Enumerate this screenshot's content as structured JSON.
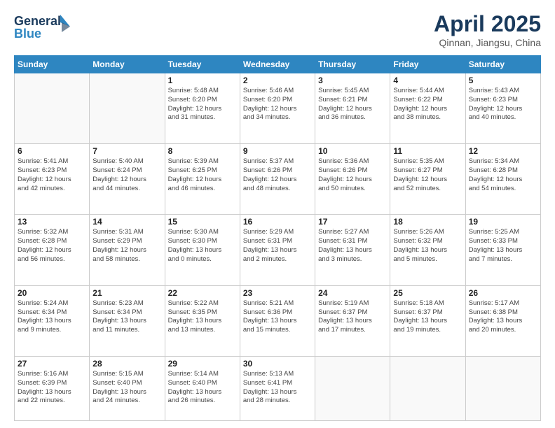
{
  "header": {
    "logo_line1": "General",
    "logo_line2": "Blue",
    "month_title": "April 2025",
    "subtitle": "Qinnan, Jiangsu, China"
  },
  "days_of_week": [
    "Sunday",
    "Monday",
    "Tuesday",
    "Wednesday",
    "Thursday",
    "Friday",
    "Saturday"
  ],
  "weeks": [
    [
      {
        "day": "",
        "info": ""
      },
      {
        "day": "",
        "info": ""
      },
      {
        "day": "1",
        "info": "Sunrise: 5:48 AM\nSunset: 6:20 PM\nDaylight: 12 hours\nand 31 minutes."
      },
      {
        "day": "2",
        "info": "Sunrise: 5:46 AM\nSunset: 6:20 PM\nDaylight: 12 hours\nand 34 minutes."
      },
      {
        "day": "3",
        "info": "Sunrise: 5:45 AM\nSunset: 6:21 PM\nDaylight: 12 hours\nand 36 minutes."
      },
      {
        "day": "4",
        "info": "Sunrise: 5:44 AM\nSunset: 6:22 PM\nDaylight: 12 hours\nand 38 minutes."
      },
      {
        "day": "5",
        "info": "Sunrise: 5:43 AM\nSunset: 6:23 PM\nDaylight: 12 hours\nand 40 minutes."
      }
    ],
    [
      {
        "day": "6",
        "info": "Sunrise: 5:41 AM\nSunset: 6:23 PM\nDaylight: 12 hours\nand 42 minutes."
      },
      {
        "day": "7",
        "info": "Sunrise: 5:40 AM\nSunset: 6:24 PM\nDaylight: 12 hours\nand 44 minutes."
      },
      {
        "day": "8",
        "info": "Sunrise: 5:39 AM\nSunset: 6:25 PM\nDaylight: 12 hours\nand 46 minutes."
      },
      {
        "day": "9",
        "info": "Sunrise: 5:37 AM\nSunset: 6:26 PM\nDaylight: 12 hours\nand 48 minutes."
      },
      {
        "day": "10",
        "info": "Sunrise: 5:36 AM\nSunset: 6:26 PM\nDaylight: 12 hours\nand 50 minutes."
      },
      {
        "day": "11",
        "info": "Sunrise: 5:35 AM\nSunset: 6:27 PM\nDaylight: 12 hours\nand 52 minutes."
      },
      {
        "day": "12",
        "info": "Sunrise: 5:34 AM\nSunset: 6:28 PM\nDaylight: 12 hours\nand 54 minutes."
      }
    ],
    [
      {
        "day": "13",
        "info": "Sunrise: 5:32 AM\nSunset: 6:28 PM\nDaylight: 12 hours\nand 56 minutes."
      },
      {
        "day": "14",
        "info": "Sunrise: 5:31 AM\nSunset: 6:29 PM\nDaylight: 12 hours\nand 58 minutes."
      },
      {
        "day": "15",
        "info": "Sunrise: 5:30 AM\nSunset: 6:30 PM\nDaylight: 13 hours\nand 0 minutes."
      },
      {
        "day": "16",
        "info": "Sunrise: 5:29 AM\nSunset: 6:31 PM\nDaylight: 13 hours\nand 2 minutes."
      },
      {
        "day": "17",
        "info": "Sunrise: 5:27 AM\nSunset: 6:31 PM\nDaylight: 13 hours\nand 3 minutes."
      },
      {
        "day": "18",
        "info": "Sunrise: 5:26 AM\nSunset: 6:32 PM\nDaylight: 13 hours\nand 5 minutes."
      },
      {
        "day": "19",
        "info": "Sunrise: 5:25 AM\nSunset: 6:33 PM\nDaylight: 13 hours\nand 7 minutes."
      }
    ],
    [
      {
        "day": "20",
        "info": "Sunrise: 5:24 AM\nSunset: 6:34 PM\nDaylight: 13 hours\nand 9 minutes."
      },
      {
        "day": "21",
        "info": "Sunrise: 5:23 AM\nSunset: 6:34 PM\nDaylight: 13 hours\nand 11 minutes."
      },
      {
        "day": "22",
        "info": "Sunrise: 5:22 AM\nSunset: 6:35 PM\nDaylight: 13 hours\nand 13 minutes."
      },
      {
        "day": "23",
        "info": "Sunrise: 5:21 AM\nSunset: 6:36 PM\nDaylight: 13 hours\nand 15 minutes."
      },
      {
        "day": "24",
        "info": "Sunrise: 5:19 AM\nSunset: 6:37 PM\nDaylight: 13 hours\nand 17 minutes."
      },
      {
        "day": "25",
        "info": "Sunrise: 5:18 AM\nSunset: 6:37 PM\nDaylight: 13 hours\nand 19 minutes."
      },
      {
        "day": "26",
        "info": "Sunrise: 5:17 AM\nSunset: 6:38 PM\nDaylight: 13 hours\nand 20 minutes."
      }
    ],
    [
      {
        "day": "27",
        "info": "Sunrise: 5:16 AM\nSunset: 6:39 PM\nDaylight: 13 hours\nand 22 minutes."
      },
      {
        "day": "28",
        "info": "Sunrise: 5:15 AM\nSunset: 6:40 PM\nDaylight: 13 hours\nand 24 minutes."
      },
      {
        "day": "29",
        "info": "Sunrise: 5:14 AM\nSunset: 6:40 PM\nDaylight: 13 hours\nand 26 minutes."
      },
      {
        "day": "30",
        "info": "Sunrise: 5:13 AM\nSunset: 6:41 PM\nDaylight: 13 hours\nand 28 minutes."
      },
      {
        "day": "",
        "info": ""
      },
      {
        "day": "",
        "info": ""
      },
      {
        "day": "",
        "info": ""
      }
    ]
  ]
}
